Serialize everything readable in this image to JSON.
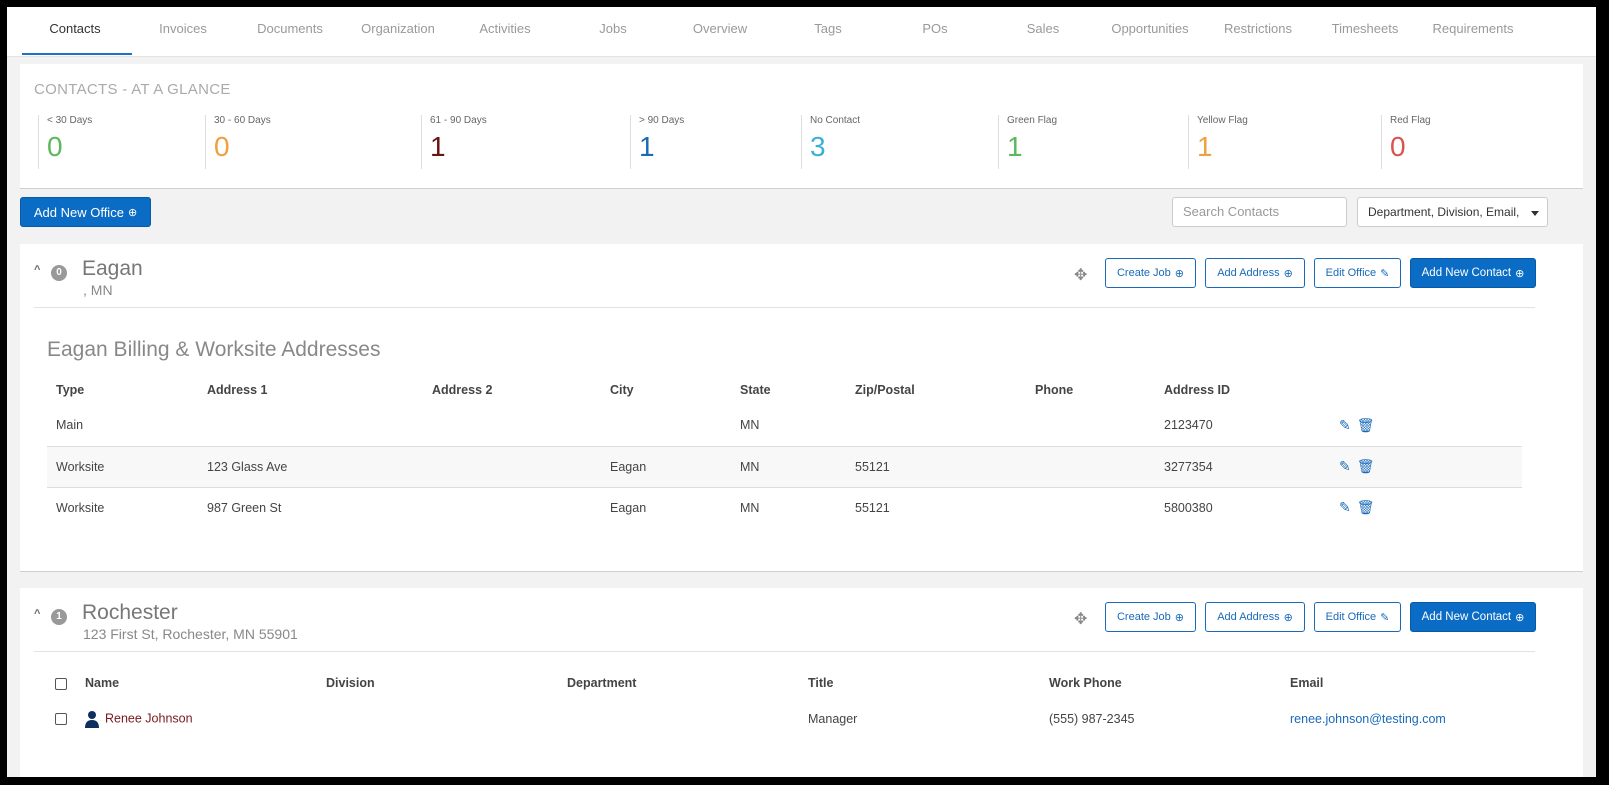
{
  "tabs": [
    "Contacts",
    "Invoices",
    "Documents",
    "Organization",
    "Activities",
    "Jobs",
    "Overview",
    "Tags",
    "POs",
    "Sales",
    "Opportunities",
    "Restrictions",
    "Timesheets",
    "Requirements"
  ],
  "glance": {
    "title": "CONTACTS - AT A GLANCE",
    "stats": [
      {
        "label": "< 30 Days",
        "value": "0",
        "color": "#5cb85c"
      },
      {
        "label": "30 - 60 Days",
        "value": "0",
        "color": "#f0a03c"
      },
      {
        "label": "61 - 90 Days",
        "value": "1",
        "color": "#6b1212"
      },
      {
        "label": "> 90 Days",
        "value": "1",
        "color": "#1a6ab8"
      },
      {
        "label": "No Contact",
        "value": "3",
        "color": "#3ab0d6"
      },
      {
        "label": "Green Flag",
        "value": "1",
        "color": "#5cb85c"
      },
      {
        "label": "Yellow Flag",
        "value": "1",
        "color": "#f0a03c"
      },
      {
        "label": "Red Flag",
        "value": "0",
        "color": "#d9534f"
      }
    ]
  },
  "toolbar": {
    "add_office_label": "Add New Office",
    "search_placeholder": "Search Contacts",
    "filter_value": "Department, Division, Email,"
  },
  "office_buttons": {
    "create_job": "Create Job",
    "add_address": "Add Address",
    "edit_office": "Edit Office",
    "add_contact": "Add New Contact"
  },
  "offices": [
    {
      "badge": "0",
      "name": "Eagan",
      "subtitle": ", MN",
      "addresses_title": "Eagan Billing & Worksite Addresses",
      "address_headers": [
        "Type",
        "Address 1",
        "Address 2",
        "City",
        "State",
        "Zip/Postal",
        "Phone",
        "Address ID"
      ],
      "addresses": [
        [
          "Main",
          "",
          "",
          "",
          "MN",
          "",
          "",
          "2123470"
        ],
        [
          "Worksite",
          "123 Glass Ave",
          "",
          "Eagan",
          "MN",
          "55121",
          "",
          "3277354"
        ],
        [
          "Worksite",
          "987 Green St",
          "",
          "Eagan",
          "MN",
          "55121",
          "",
          "5800380"
        ]
      ]
    },
    {
      "badge": "1",
      "name": "Rochester",
      "subtitle": "123 First St, Rochester, MN 55901",
      "contact_headers": [
        "Name",
        "Division",
        "Department",
        "Title",
        "Work Phone",
        "Email"
      ],
      "contacts": [
        {
          "name": "Renee Johnson",
          "division": "",
          "department": "",
          "title": "Manager",
          "phone": "(555) 987-2345",
          "email": "renee.johnson@testing.com"
        }
      ]
    }
  ]
}
